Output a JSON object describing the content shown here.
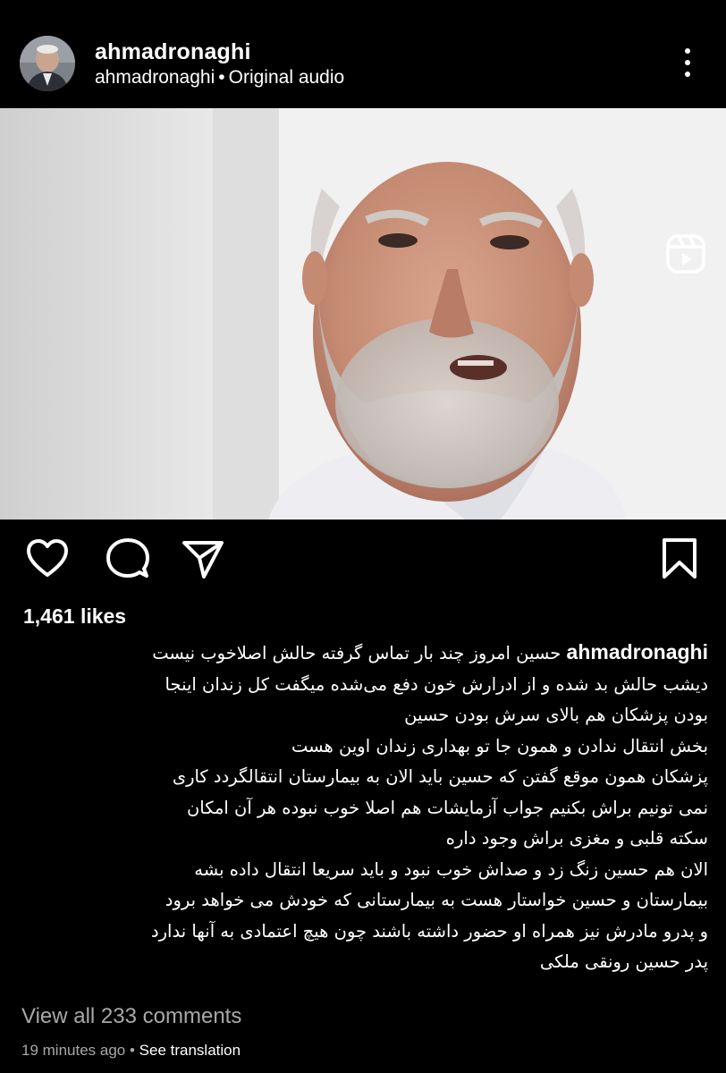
{
  "header": {
    "username": "ahmadronaghi",
    "subline_user": "ahmadronaghi",
    "separator": "•",
    "audio_label": "Original audio",
    "avatar_icon": "profile-photo",
    "more_icon": "vertical-ellipsis-icon"
  },
  "video": {
    "type_icon": "reels-icon",
    "mute_icon": "speaker-muted-icon"
  },
  "actions": {
    "like_icon": "heart-outline-icon",
    "comment_icon": "speech-bubble-icon",
    "share_icon": "paper-plane-icon",
    "save_icon": "bookmark-outline-icon"
  },
  "likes": "1,461 likes",
  "caption": {
    "username": "ahmadronaghi",
    "lines": [
      "حسین امروز چند بار  تماس گرفته حالش اصلاخوب نیست",
      "دیشب حالش بد شده و از ادرارش خون دفع می‌شده  میگفت کل زندان اینجا",
      "بودن پزشکان هم بالای سرش بودن حسین",
      " بخش انتقال ندادن و همون جا تو بهداری زندان اوین هست",
      "پزشکان همون موقع گفتن که حسین باید الان به بیمارستان انتقالگردد  کاری",
      "نمی تونیم براش بکنیم جواب آزمایشات هم اصلا خوب نبوده هر آن امکان",
      "سکته قلبی و مغزی براش وجود داره",
      "الان هم حسین زنگ زد و صداش خوب نبود و باید سریعا انتقال داده بشه",
      "بیمارستان  و حسین خواستار هست به بیمارستانی که  خودش می خواهد برود",
      "و پدرو مادرش نیز همراه او حضور داشته باشند چون هیچ اعتمادی به آنها ندارد",
      "پدر حسین رونقی ملکی"
    ]
  },
  "comments_link": "View all 233 comments",
  "meta": {
    "time": "19 minutes ago",
    "separator": "•",
    "translate": "See translation"
  },
  "colors": {
    "background": "#000000",
    "text": "#ffffff",
    "muted_text": "#a8a8a8"
  }
}
